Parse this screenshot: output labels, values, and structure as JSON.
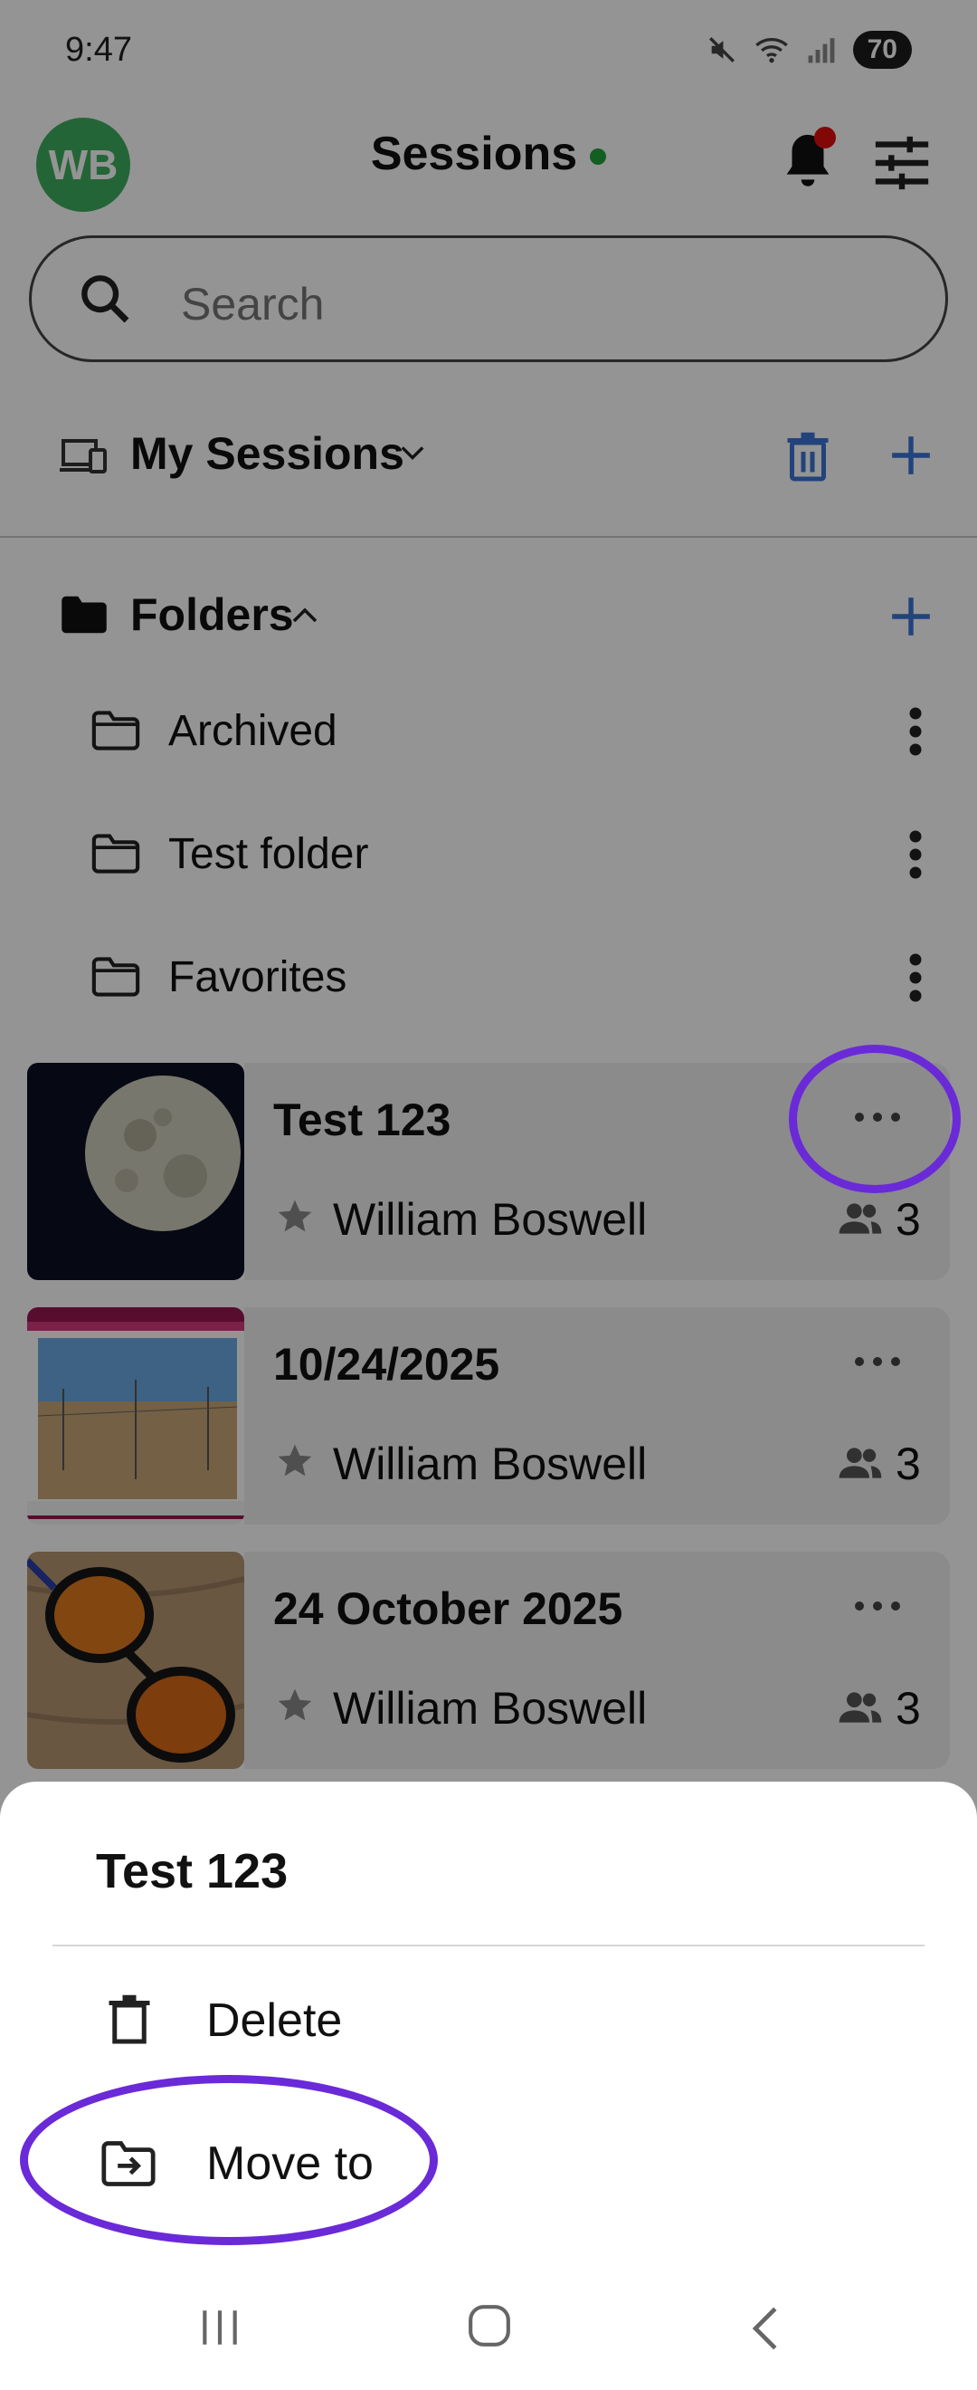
{
  "status_bar": {
    "time": "9:47",
    "battery": "70",
    "signal_label": "6"
  },
  "header": {
    "avatar_initials": "WB",
    "title": "Sessions",
    "status_dot_color": "#22a33a",
    "notification_dot_color": "#e10f0f"
  },
  "search": {
    "placeholder": "Search"
  },
  "sessions_section": {
    "label": "My Sessions",
    "accent_color": "#3b74d6"
  },
  "folders": {
    "label": "Folders",
    "items": [
      {
        "label": "Archived"
      },
      {
        "label": "Test folder"
      },
      {
        "label": "Favorites"
      }
    ]
  },
  "sessions": [
    {
      "title": "Test 123",
      "owner": "William Boswell",
      "participants": "3",
      "thumb": "moon"
    },
    {
      "title": "10/24/2025",
      "owner": "William Boswell",
      "participants": "3",
      "thumb": "field"
    },
    {
      "title": "24 October 2025",
      "owner": "William Boswell",
      "participants": "3",
      "thumb": "glasses"
    }
  ],
  "sheet": {
    "title": "Test 123",
    "actions": [
      {
        "label": "Delete",
        "icon": "trash-icon"
      },
      {
        "label": "Move to",
        "icon": "folder-move-icon"
      }
    ]
  },
  "annotation_color": "#6a2ad8"
}
